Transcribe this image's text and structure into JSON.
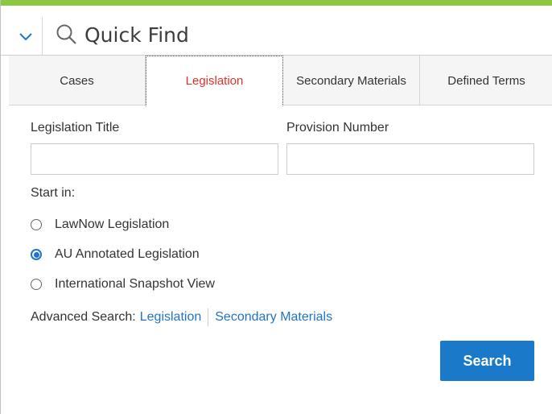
{
  "header": {
    "title": "Quick Find",
    "toggle_icon": "chevron-down-icon",
    "search_icon": "search-icon"
  },
  "colors": {
    "accent_bar": "#8dc63f",
    "active_tab": "#e0322a",
    "link": "#1f73c9",
    "button": "#1a7ac9"
  },
  "tabs": [
    {
      "label": "Cases",
      "active": false
    },
    {
      "label": "Legislation",
      "active": true
    },
    {
      "label": "Secondary Materials",
      "active": false
    },
    {
      "label": "Defined Terms",
      "active": false
    }
  ],
  "form": {
    "legislation_title_label": "Legislation Title",
    "legislation_title_value": "",
    "provision_number_label": "Provision Number",
    "provision_number_value": "",
    "start_in_label": "Start in:",
    "options": [
      {
        "label": "LawNow Legislation",
        "checked": false
      },
      {
        "label": "AU Annotated Legislation",
        "checked": true
      },
      {
        "label": "International Snapshot View",
        "checked": false
      }
    ]
  },
  "advanced": {
    "label": "Advanced Search:",
    "links": [
      "Legislation",
      "Secondary Materials"
    ]
  },
  "search_button": "Search"
}
